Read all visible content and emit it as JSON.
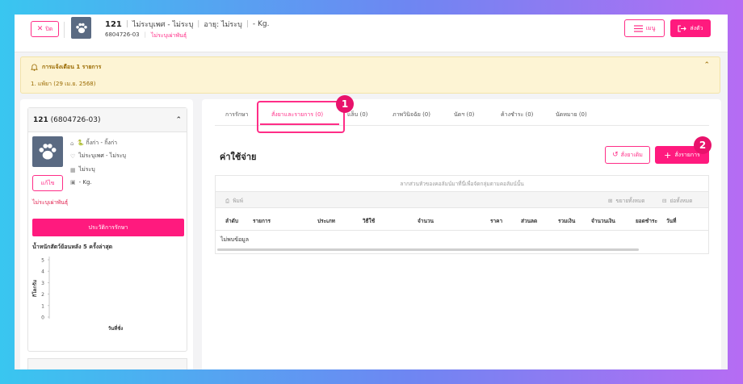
{
  "header": {
    "close_label": "ปิด",
    "pet_id": "121",
    "breed": "ไม่ระบุเพศ - ไม่ระบุ",
    "age": "อายุ: ไม่ระบุ",
    "weight": "- Kg.",
    "hn": "6804726-03",
    "status": "ไม่ระบุเผ่าพันธุ์",
    "menu_label": "เมนู",
    "send_label": "ส่งตัว"
  },
  "alert": {
    "title": "การแจ้งเตือน 1 รายการ",
    "line1": "1. แพ้ยา (29 เม.ย. 2568)"
  },
  "left_card": {
    "title_id": "121",
    "title_hn": "(6804726-03)",
    "info_species": "🐍 กิ้งก่า - กิ้งก่า",
    "info_gender": "ไม่ระบุเพศ - ไม่ระบุ",
    "info_age": "ไม่ระบุ",
    "info_weight": "- Kg.",
    "edit_label": "แก้ไข",
    "unknown_text": "ไม่ระบุเผ่าพันธุ์",
    "history_label": "ประวัติการรักษา",
    "weight_chart_title": "น้ำหนักสัตว์ย้อนหลัง 5 ครั้งล่าสุด"
  },
  "chart_data": {
    "type": "line",
    "title": "น้ำหนักสัตว์ย้อนหลัง 5 ครั้งล่าสุด",
    "xlabel": "วันที่ชั่ง",
    "ylabel": "กิโลกรัม",
    "yticks": [
      "0",
      "1",
      "2",
      "3",
      "4",
      "5"
    ],
    "ylim": [
      0,
      5
    ],
    "series": []
  },
  "tabs": [
    {
      "label": "การรักษา"
    },
    {
      "label": "สั่งยาและรายการ (0)"
    },
    {
      "label": "แล็บ (0)"
    },
    {
      "label": "ภาพวินิจฉัย (0)"
    },
    {
      "label": "นัดฯ (0)"
    },
    {
      "label": "ค้างชำระ (0)"
    },
    {
      "label": "นัดหมาย (0)"
    }
  ],
  "markers": {
    "one": "1",
    "two": "2"
  },
  "main": {
    "section_title": "ค่าใช้จ่าย",
    "order_med_label": "สั่งยาเดิม",
    "order_label": "สั่งรายการ",
    "drag_hint": "ลากส่วนหัวของคอลัมน์มาที่นี่เพื่อจัดกลุ่มตามคอลัมน์นั้น",
    "print_label": "พิมพ์",
    "expand_label": "ขยายทั้งหมด",
    "collapse_label": "ย่อทั้งหมด",
    "columns": [
      "ลำดับ",
      "รายการ",
      "ประเภท",
      "วิธีใช้",
      "จำนวน",
      "ราคา",
      "ส่วนลด",
      "รวมเงิน",
      "จำนวนเงิน",
      "ยอดชำระ",
      "วันที่"
    ],
    "no_data": "ไม่พบข้อมูล"
  },
  "colors": {
    "accent": "#ff1a7e",
    "alert_bg": "#fdf4d4"
  }
}
